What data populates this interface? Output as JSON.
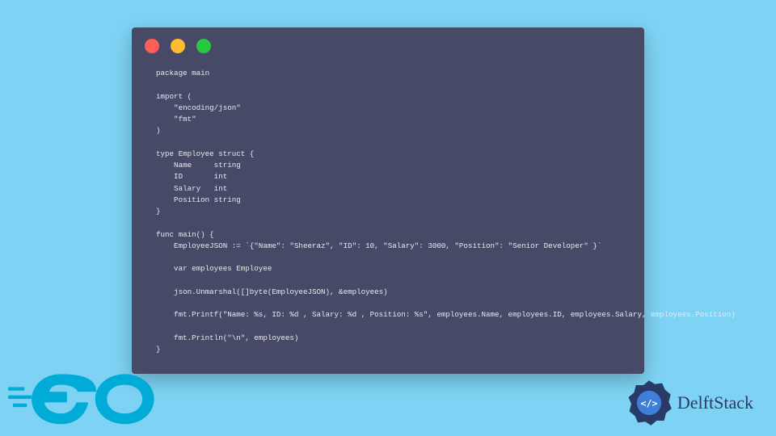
{
  "window": {
    "dots": {
      "red": "#ff5f56",
      "yellow": "#ffbd2e",
      "green": "#27c93f"
    }
  },
  "code": {
    "lines": [
      "package main",
      "",
      "import (",
      "    \"encoding/json\"",
      "    \"fmt\"",
      ")",
      "",
      "type Employee struct {",
      "    Name     string",
      "    ID       int",
      "    Salary   int",
      "    Position string",
      "}",
      "",
      "func main() {",
      "    EmployeeJSON := `{\"Name\": \"Sheeraz\", \"ID\": 10, \"Salary\": 3000, \"Position\": \"Senior Developer\" }`",
      "",
      "    var employees Employee",
      "",
      "    json.Unmarshal([]byte(EmployeeJSON), &employees)",
      "",
      "    fmt.Printf(\"Name: %s, ID: %d , Salary: %d , Position: %s\", employees.Name, employees.ID, employees.Salary, employees.Position)",
      "",
      "    fmt.Println(\"\\n\", employees)",
      "}"
    ]
  },
  "logos": {
    "go_color": "#00acd7",
    "delftstack_label": "DelftStack",
    "delftstack_color": "#2a3a66"
  }
}
